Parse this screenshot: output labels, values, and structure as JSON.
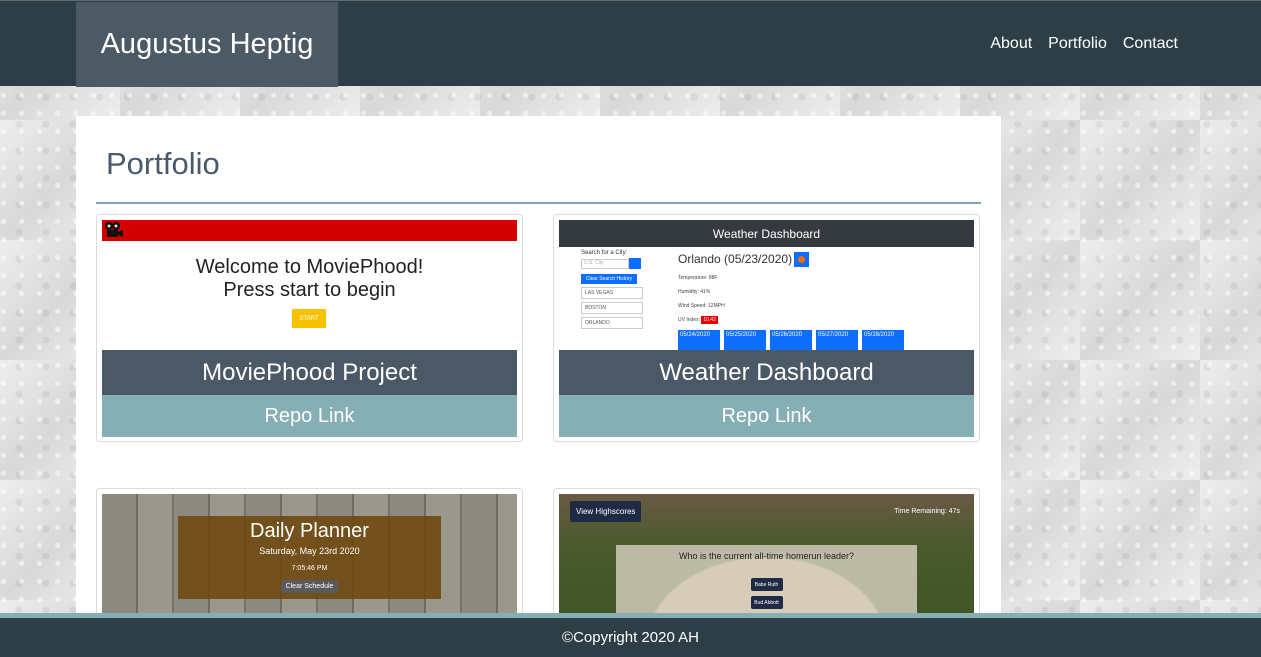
{
  "header": {
    "brand": "Augustus Heptig",
    "nav": [
      "About",
      "Portfolio",
      "Contact"
    ]
  },
  "page": {
    "title": "Portfolio"
  },
  "projects": [
    {
      "title": "MoviePhood Project",
      "link": "Repo Link",
      "thumb": {
        "line1": "Welcome to MoviePhood!",
        "line2": "Press start to begin",
        "button": "START"
      }
    },
    {
      "title": "Weather Dashboard",
      "link": "Repo Link",
      "thumb": {
        "header": "Weather Dashboard",
        "search_label": "Search for a City:",
        "search_placeholder": "U.S. City",
        "clear_button": "Clear Search History",
        "cities": [
          "LAS VEGAS",
          "BOSTON",
          "ORLANDO"
        ],
        "city_date": "Orlando (05/23/2020)",
        "temp": "Temperature: 88F",
        "humidity": "Humidity: 41%",
        "wind": "Wind Speed: 12MPH",
        "uv_label": "UV Index:",
        "uv_value": "10.42",
        "days": [
          "05/24/2020",
          "05/25/2020",
          "05/26/2020",
          "05/27/2020",
          "05/28/2020"
        ]
      }
    },
    {
      "title": "",
      "link": "",
      "thumb": {
        "title": "Daily Planner",
        "date": "Saturday, May 23rd 2020",
        "time": "7:05:46 PM",
        "button": "Clear Schedule"
      }
    },
    {
      "title": "",
      "link": "",
      "thumb": {
        "highscores": "View Highscores",
        "time": "Time Remaining: 47s",
        "question": "Who is the current all-time homerun leader?",
        "answers": [
          "Babe Ruth",
          "Bud Abbott"
        ]
      }
    }
  ],
  "footer": {
    "copyright": "©Copyright 2020 AH"
  },
  "colors": {
    "header": "#2e3e46",
    "brand_bg": "#4c5a66",
    "title_bar": "#4b5866",
    "link_bar": "#86aeb5"
  }
}
